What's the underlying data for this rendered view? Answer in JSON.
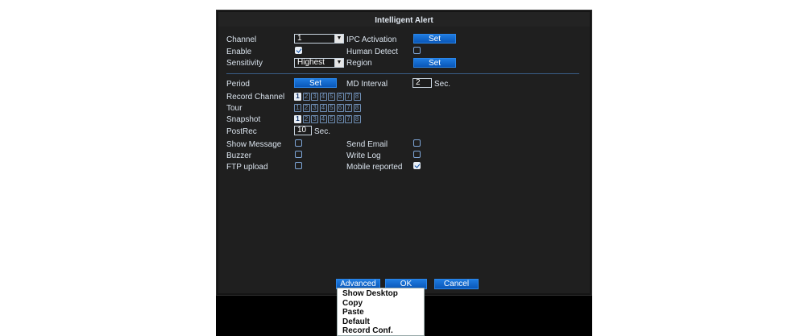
{
  "dialog": {
    "title": "Intelligent Alert"
  },
  "fields": {
    "channel": {
      "label": "Channel",
      "value": "1"
    },
    "enable": {
      "label": "Enable",
      "checked": true
    },
    "sensitivity": {
      "label": "Sensitivity",
      "value": "Highest"
    },
    "ipc_activation": {
      "label": "IPC Activation",
      "button": "Set"
    },
    "human_detect": {
      "label": "Human Detect",
      "checked": false
    },
    "region": {
      "label": "Region",
      "button": "Set"
    },
    "period": {
      "label": "Period",
      "button": "Set"
    },
    "md_interval": {
      "label": "MD Interval",
      "value": "2",
      "unit": "Sec."
    },
    "record_channel": {
      "label": "Record Channel",
      "channels": [
        "1",
        "2",
        "3",
        "4",
        "5",
        "6",
        "7",
        "8"
      ],
      "selected": [
        "1"
      ]
    },
    "tour": {
      "label": "Tour",
      "channels": [
        "1",
        "2",
        "3",
        "4",
        "5",
        "6",
        "7",
        "8"
      ],
      "selected": []
    },
    "snapshot": {
      "label": "Snapshot",
      "channels": [
        "1",
        "2",
        "3",
        "4",
        "5",
        "6",
        "7",
        "8"
      ],
      "selected": [
        "1"
      ]
    },
    "postrec": {
      "label": "PostRec",
      "value": "10",
      "unit": "Sec."
    },
    "show_message": {
      "label": "Show Message",
      "checked": false
    },
    "buzzer": {
      "label": "Buzzer",
      "checked": false
    },
    "ftp_upload": {
      "label": "FTP upload",
      "checked": false
    },
    "send_email": {
      "label": "Send Email",
      "checked": false
    },
    "write_log": {
      "label": "Write Log",
      "checked": false
    },
    "mobile_reported": {
      "label": "Mobile reported",
      "checked": true
    }
  },
  "footer": {
    "advanced": "Advanced",
    "ok": "OK",
    "cancel": "Cancel"
  },
  "context_menu": {
    "items": [
      "Show Desktop",
      "Copy",
      "Paste",
      "Default",
      "Record Conf."
    ]
  },
  "colors": {
    "accent": "#0a57b8",
    "dialog_bg": "#1f1f1f",
    "text": "#d9e2ec",
    "divider": "#3a5d87"
  }
}
